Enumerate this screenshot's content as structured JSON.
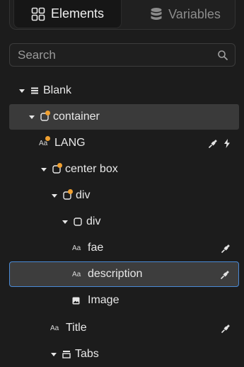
{
  "tabs": {
    "elements_label": "Elements",
    "variables_label": "Variables"
  },
  "search": {
    "placeholder": "Search"
  },
  "tree": {
    "blank": "Blank",
    "container": "container",
    "lang": "LANG",
    "center_box": "center box",
    "div_outer": "div",
    "div_inner": "div",
    "fae": "fae",
    "description": "description",
    "image": "Image",
    "title": "Title",
    "tabs": "Tabs"
  },
  "icons": {
    "text": "Aa",
    "accent_dot_color": "#f0a030",
    "selection_border_color": "#4a8ad6"
  }
}
